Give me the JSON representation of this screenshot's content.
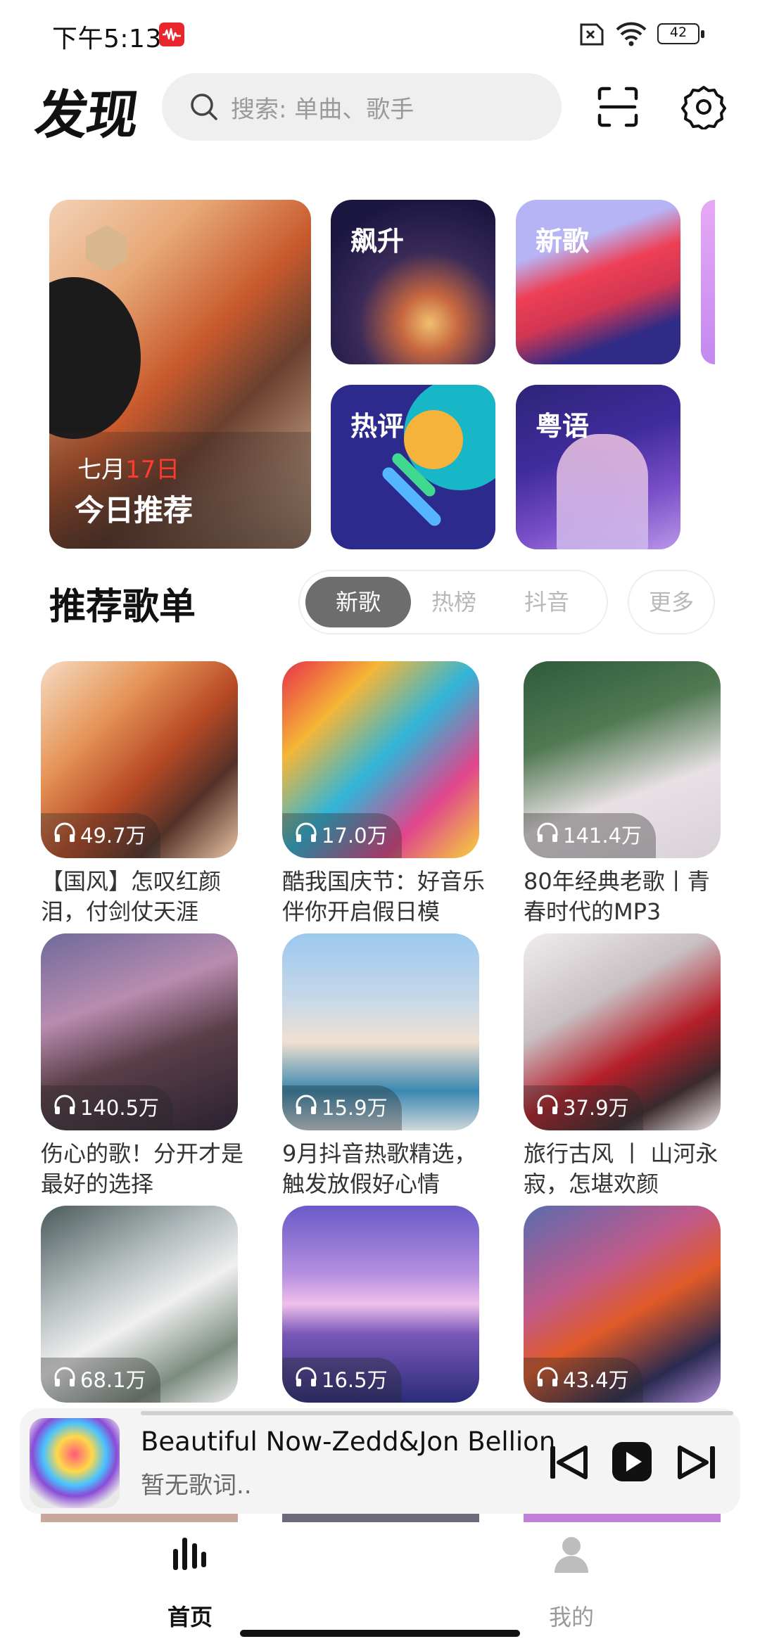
{
  "status_bar": {
    "time": "下午5:13",
    "battery": "42"
  },
  "header": {
    "title": "发现",
    "search_placeholder": "搜索: 单曲、歌手"
  },
  "featured": {
    "month": "七月",
    "day": "17日",
    "label": "今日推荐"
  },
  "tiles": [
    {
      "label": "飙升"
    },
    {
      "label": "新歌"
    },
    {
      "label": "热评"
    },
    {
      "label": "粤语"
    }
  ],
  "section": {
    "title": "推荐歌单",
    "tabs": [
      "新歌",
      "热榜",
      "抖音"
    ],
    "active_tab": "新歌",
    "more": "更多"
  },
  "playlists": [
    {
      "count": "49.7万",
      "caption": "【国风】怎叹红颜泪，付剑仗天涯"
    },
    {
      "count": "17.0万",
      "caption": "酷我国庆节：好音乐伴你开启假日模"
    },
    {
      "count": "141.4万",
      "caption": "80年经典老歌丨青春时代的MP3"
    },
    {
      "count": "140.5万",
      "caption": "伤心的歌！分开才是最好的选择"
    },
    {
      "count": "15.9万",
      "caption": "9月抖音热歌精选，触发放假好心情"
    },
    {
      "count": "37.9万",
      "caption": "旅行古风 丨 山河永寂，怎堪欢颜"
    },
    {
      "count": "68.1万",
      "caption": ""
    },
    {
      "count": "16.5万",
      "caption": ""
    },
    {
      "count": "43.4万",
      "caption": ""
    }
  ],
  "player": {
    "song": "Beautiful Now-Zedd&Jon Bellion",
    "lyric": "暂无歌词.."
  },
  "nav": {
    "home": "首页",
    "mine": "我的"
  },
  "colors": {
    "accent_red": "#ff3b30",
    "active_tab_bg": "#6d6d6d",
    "search_bg": "#efefef"
  }
}
